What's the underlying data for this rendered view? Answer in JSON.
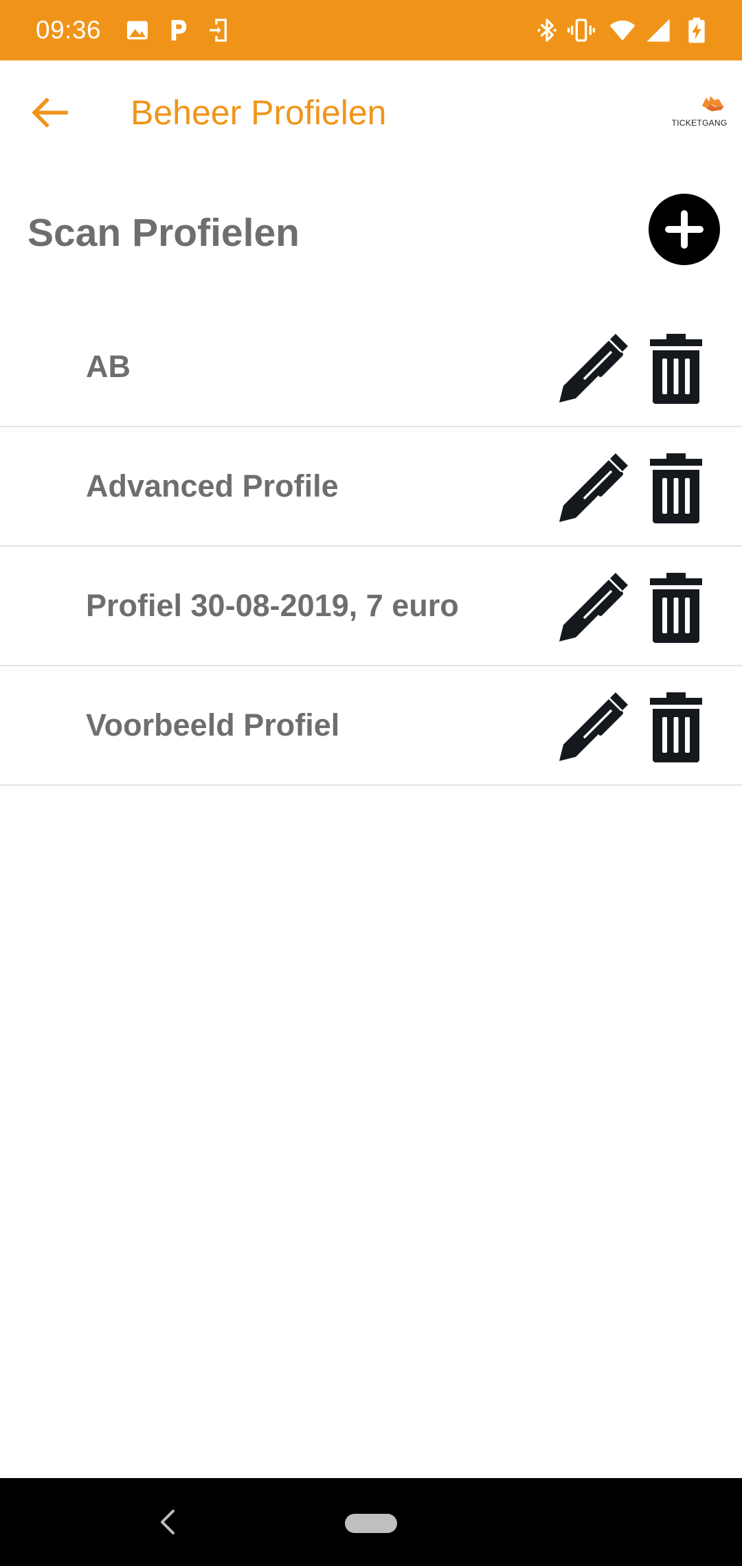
{
  "status_bar": {
    "time": "09:36",
    "background_color": "#f09419",
    "left_icons": [
      "image-icon",
      "parking-icon",
      "screen-cast-icon"
    ],
    "right_icons": [
      "bluetooth-icon",
      "vibrate-icon",
      "wifi-icon",
      "signal-icon",
      "battery-charging-icon"
    ]
  },
  "app_bar": {
    "title": "Beheer Profielen",
    "back_icon": "arrow-left-icon",
    "logo_text": "TICKETGANG",
    "accent_color": "#f09419"
  },
  "section": {
    "title": "Scan Profielen",
    "add_icon": "plus-circle-icon"
  },
  "profiles": [
    {
      "name": "AB",
      "edit_icon": "pencil-icon",
      "delete_icon": "trash-icon"
    },
    {
      "name": "Advanced Profile",
      "edit_icon": "pencil-icon",
      "delete_icon": "trash-icon"
    },
    {
      "name": "Profiel 30-08-2019, 7 euro",
      "edit_icon": "pencil-icon",
      "delete_icon": "trash-icon"
    },
    {
      "name": "Voorbeeld Profiel",
      "edit_icon": "pencil-icon",
      "delete_icon": "trash-icon"
    }
  ],
  "nav_bar": {
    "back_icon": "nav-back-icon",
    "home_icon": "home-pill-icon"
  }
}
